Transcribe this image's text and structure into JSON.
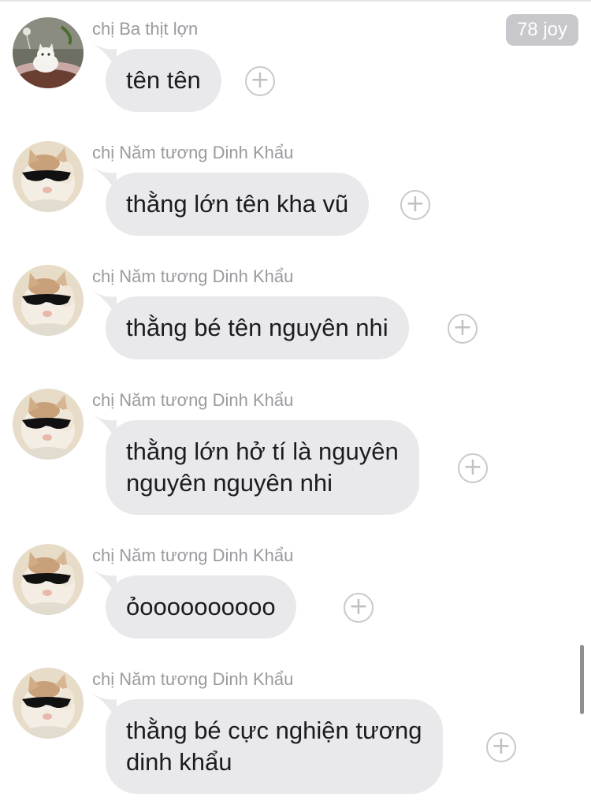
{
  "header": {
    "badge": "78 joy"
  },
  "messages": [
    {
      "sender": "chị Ba thịt lợn",
      "lines": [
        "tên tên"
      ],
      "avatar": "white-cat-avatar"
    },
    {
      "sender": "chị Năm tương Dinh Khẩu",
      "lines": [
        "thằng lớn tên kha vũ"
      ],
      "avatar": "sunglasses-cat-avatar"
    },
    {
      "sender": "chị Năm tương Dinh Khẩu",
      "lines": [
        "thằng bé tên nguyên nhi"
      ],
      "avatar": "sunglasses-cat-avatar"
    },
    {
      "sender": "chị Năm tương Dinh Khẩu",
      "lines": [
        "thằng lớn hở tí là nguyên",
        "nguyên nguyên nhi"
      ],
      "avatar": "sunglasses-cat-avatar"
    },
    {
      "sender": "chị Năm tương Dinh Khẩu",
      "lines": [
        "ỏoooooooooo"
      ],
      "avatar": "sunglasses-cat-avatar"
    },
    {
      "sender": "chị Năm tương Dinh Khẩu",
      "lines": [
        "thằng bé cực nghiện tương",
        "dinh khẩu"
      ],
      "avatar": "sunglasses-cat-avatar"
    }
  ],
  "reaction_glyph": "+",
  "colors": {
    "bubble": "#e9e9ec",
    "sender": "#9a9a9f",
    "text": "#1c1c1e",
    "badge": "#c7c7cc"
  }
}
